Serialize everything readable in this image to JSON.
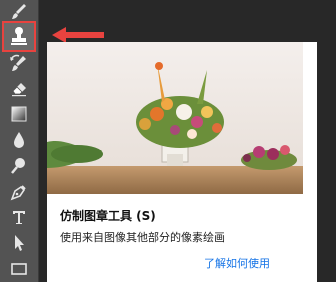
{
  "toolbar": {
    "tools": [
      "brush-icon",
      "clone-stamp-icon",
      "history-brush-icon",
      "eraser-icon",
      "gradient-icon",
      "blur-drop-icon",
      "dodge-icon",
      "pen-icon",
      "type-icon",
      "path-select-icon",
      "rectangle-icon"
    ],
    "selected": "clone-stamp-icon",
    "highlight_color": "#e8433f"
  },
  "tooltip": {
    "title": "仿制图章工具 (S)",
    "description": "使用来自图像其他部分的像素绘画",
    "link": "了解如何使用"
  }
}
